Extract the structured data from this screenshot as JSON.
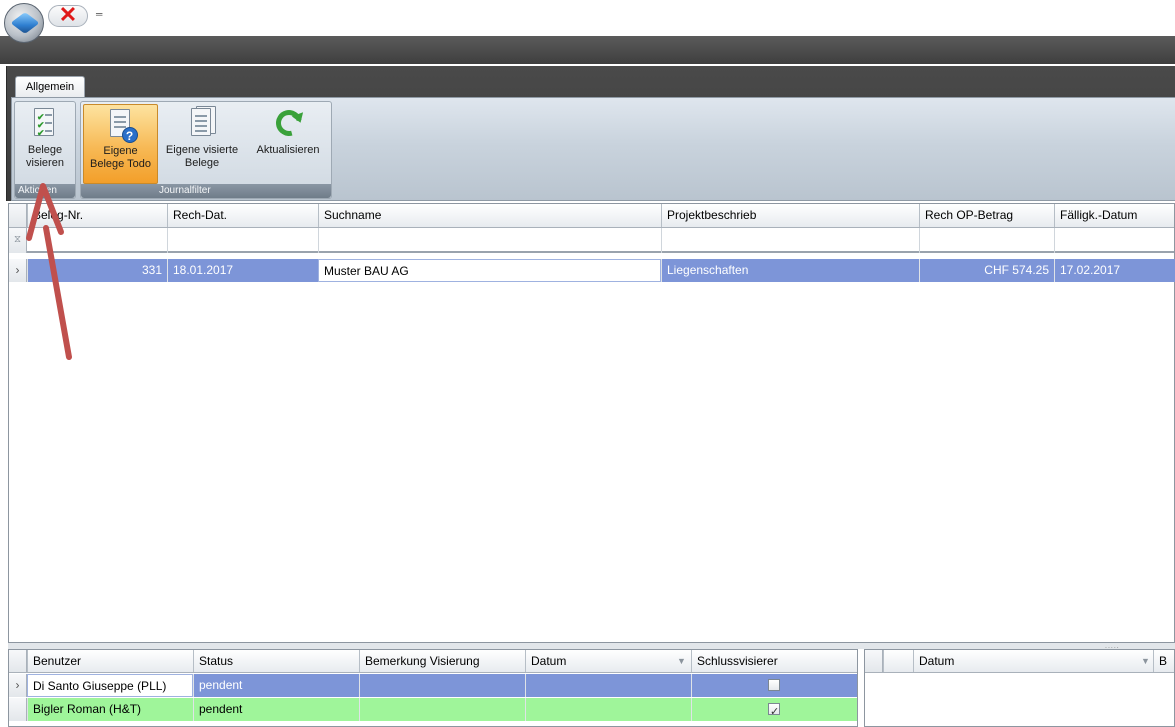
{
  "qat": {
    "close_icon": "close-x-icon",
    "customize_glyph": "═"
  },
  "ribbon": {
    "tab": "Allgemein",
    "groups": [
      {
        "label": "Aktionen",
        "buttons": [
          {
            "line1": "Belege",
            "line2": "visieren",
            "icon": "approve-documents-icon"
          }
        ]
      },
      {
        "label": "Journalfilter",
        "buttons": [
          {
            "line1": "Eigene",
            "line2": "Belege Todo",
            "icon": "document-question-icon",
            "active": true
          },
          {
            "line1": "Eigene visierte",
            "line2": "Belege",
            "icon": "documents-icon"
          },
          {
            "line1": "Aktualisieren",
            "line2": "",
            "icon": "refresh-icon"
          }
        ]
      }
    ]
  },
  "main_grid": {
    "columns": [
      "Beleg-Nr.",
      "Rech-Dat.",
      "Suchname",
      "Projektbeschrieb",
      "Rech OP-Betrag",
      "Fälligk.-Datum"
    ],
    "filter_icon": "filter-icon",
    "rows": [
      {
        "beleg_nr": "331",
        "rech_dat": "18.01.2017",
        "suchname": "Muster BAU AG",
        "projekt": "Liegenschaften",
        "betrag": "CHF 574.25",
        "faellig": "17.02.2017"
      }
    ]
  },
  "visa_grid": {
    "columns": [
      "Benutzer",
      "Status",
      "Bemerkung Visierung",
      "Datum",
      "Schlussvisierer"
    ],
    "rows": [
      {
        "benutzer": "Di Santo Giuseppe (PLL)",
        "status": "pendent",
        "bemerkung": "",
        "datum": "",
        "schluss": false
      },
      {
        "benutzer": "Bigler Roman (H&T)",
        "status": "pendent",
        "bemerkung": "",
        "datum": "",
        "schluss": true
      }
    ]
  },
  "right_grid": {
    "columns": [
      "Datum",
      "B"
    ]
  },
  "colors": {
    "selection": "#7d95d8",
    "green_row": "#9ff59a",
    "arrow": "#c0504d",
    "active_button": "#f7b955"
  }
}
